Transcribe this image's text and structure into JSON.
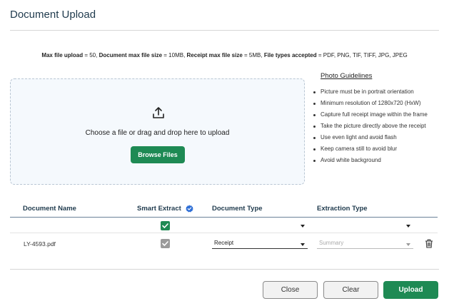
{
  "dialog": {
    "title": "Document Upload"
  },
  "limits": {
    "max_file_upload_label": "Max file upload",
    "max_file_upload_value": " = 50, ",
    "doc_max_size_label": "Document max file size",
    "doc_max_size_value": " = 10MB, ",
    "receipt_max_size_label": "Receipt max file size",
    "receipt_max_size_value": " = 5MB, ",
    "file_types_label": "File types accepted",
    "file_types_value": " = PDF, PNG, TIF, TIFF, JPG, JPEG"
  },
  "dropzone": {
    "text": "Choose a file or drag and drop here to upload",
    "browse_label": "Browse Files",
    "icon": "upload-icon"
  },
  "guidelines": {
    "title": "Photo Guidelines",
    "items": [
      "Picture must be in portrait orientation",
      "Minimum resolution of 1280x720 (HxW)",
      "Capture full receipt image within the frame",
      "Take the picture directly above the receipt",
      "Use even light and avoid flash",
      "Keep camera still to avoid blur",
      "Avoid white background"
    ]
  },
  "table": {
    "columns": [
      "Document Name",
      "Smart Extract",
      "Document Type",
      "Extraction Type"
    ],
    "bulk_row": {
      "smart_extract": true,
      "document_type": "",
      "extraction_type": ""
    },
    "rows": [
      {
        "name": "LY-4593.pdf",
        "smart_extract": true,
        "document_type": "Receipt",
        "extraction_type": "Summary"
      }
    ]
  },
  "footer": {
    "close_label": "Close",
    "clear_label": "Clear",
    "upload_label": "Upload"
  },
  "colors": {
    "primary": "#1e8a54",
    "info": "#2f6fd6",
    "title": "#1f3a4d"
  }
}
